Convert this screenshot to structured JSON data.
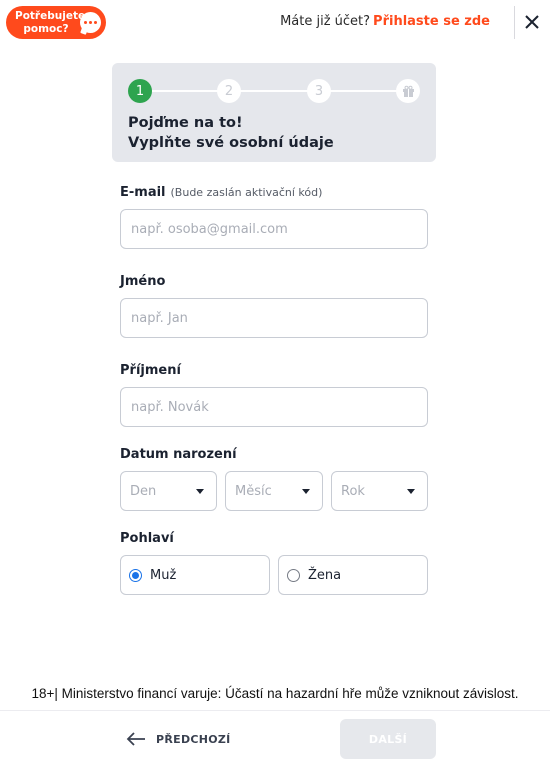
{
  "header": {
    "help_label": "Potřebujete pomoc?",
    "account_question": "Máte již účet?",
    "login_link": "Přihlaste se zde"
  },
  "stepper": {
    "steps": [
      "1",
      "2",
      "3"
    ],
    "final_step_icon": "gift-icon",
    "active_step": 1,
    "title_line1": "Pojďme na to!",
    "title_line2": "Vyplňte své osobní údaje"
  },
  "form": {
    "email": {
      "label": "E-mail",
      "hint": "(Bude zaslán aktivační kód)",
      "placeholder": "např. osoba@gmail.com",
      "value": ""
    },
    "first_name": {
      "label": "Jméno",
      "placeholder": "např. Jan",
      "value": ""
    },
    "last_name": {
      "label": "Příjmení",
      "placeholder": "např. Novák",
      "value": ""
    },
    "birth_date": {
      "label": "Datum narození",
      "day": "Den",
      "month": "Měsíc",
      "year": "Rok"
    },
    "gender": {
      "label": "Pohlaví",
      "options": [
        "Muž",
        "Žena"
      ],
      "selected": "Muž"
    }
  },
  "disclaimer": "18+| Ministerstvo financí varuje: Účastí na hazardní hře může vzniknout závislost.",
  "footer": {
    "prev_label": "PŘEDCHOZÍ",
    "next_label": "DALŠÍ"
  },
  "colors": {
    "brand": "#ff4a1c",
    "step_active": "#2ea44f",
    "radio_selected": "#1a73e8",
    "stepper_bg": "#e5e7ec"
  }
}
